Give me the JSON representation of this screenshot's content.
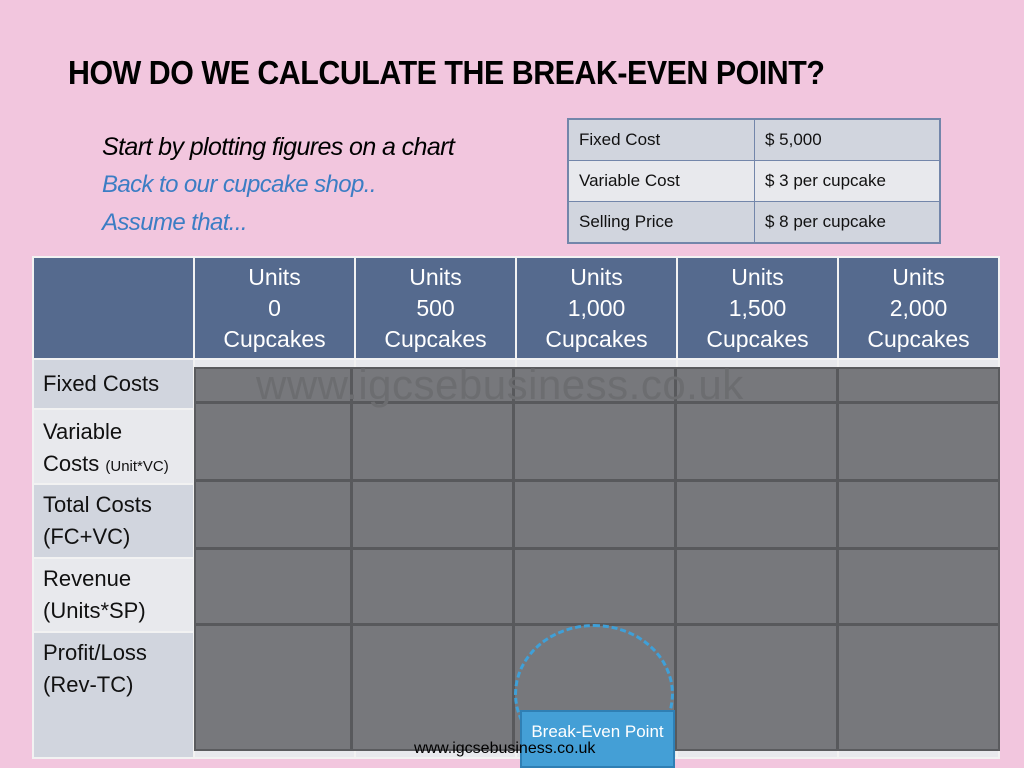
{
  "slide": {
    "title": "HOW DO WE CALCULATE THE BREAK-EVEN POINT?",
    "intro": [
      "Start by plotting figures on a chart",
      "Back to our cupcake shop..",
      "Assume that..."
    ],
    "colors": {
      "background": "#f2c6de",
      "header": "#556a8e",
      "accent": "#449fd6",
      "cover": "#77787c"
    }
  },
  "assumptions": [
    {
      "key": "Fixed Cost",
      "value": "$ 5,000"
    },
    {
      "key": "Variable Cost",
      "value": "$ 3 per cupcake"
    },
    {
      "key": "Selling Price",
      "value": "$ 8 per cupcake"
    }
  ],
  "table": {
    "columns": [
      {
        "l1": "Units",
        "l2": "0",
        "l3": "Cupcakes"
      },
      {
        "l1": "Units",
        "l2": "500",
        "l3": "Cupcakes"
      },
      {
        "l1": "Units",
        "l2": "1,000",
        "l3": "Cupcakes"
      },
      {
        "l1": "Units",
        "l2": "1,500",
        "l3": "Cupcakes"
      },
      {
        "l1": "Units",
        "l2": "2,000",
        "l3": "Cupcakes"
      }
    ],
    "rows": [
      {
        "l1": "Fixed Costs",
        "l2": "",
        "note": ""
      },
      {
        "l1": "Variable",
        "l2": "Costs",
        "note": "(Unit*VC)"
      },
      {
        "l1": "Total Costs",
        "l2": "(FC+VC)",
        "note": ""
      },
      {
        "l1": "Revenue",
        "l2": "(Units*SP)",
        "note": ""
      },
      {
        "l1": "Profit/Loss",
        "l2": "(Rev-TC)",
        "note": ""
      }
    ]
  },
  "watermark": "www.igcsebusiness.co.uk",
  "break_even_label": "Break-Even Point",
  "footer": "www.igcsebusiness.co.uk"
}
